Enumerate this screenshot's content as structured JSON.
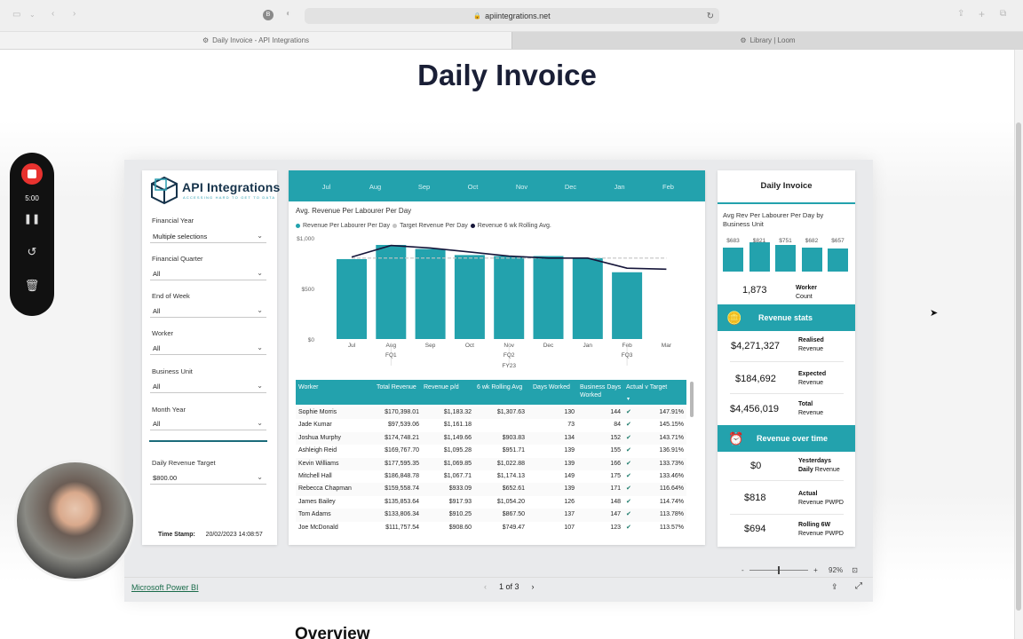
{
  "browser": {
    "url": "apiintegrations.net",
    "tabs": [
      {
        "label": "Daily Invoice - API Integrations"
      },
      {
        "label": "Library | Loom"
      }
    ]
  },
  "page": {
    "title": "Daily Invoice",
    "next_section": "Overview"
  },
  "filters": {
    "logo_name": "API Integrations",
    "logo_tagline": "ACCESSING HARD TO GET TO DATA",
    "fields": [
      {
        "label": "Financial Year",
        "value": "Multiple selections"
      },
      {
        "label": "Financial Quarter",
        "value": "All"
      },
      {
        "label": "End of Week",
        "value": "All"
      },
      {
        "label": "Worker",
        "value": "All"
      },
      {
        "label": "Business Unit",
        "value": "All"
      },
      {
        "label": "Month Year",
        "value": "All"
      },
      {
        "label": "Daily Revenue Target",
        "value": "$800.00"
      }
    ],
    "timestamp_label": "Time Stamp:",
    "timestamp_value": "20/02/2023 14:08:57"
  },
  "months": [
    "Jul",
    "Aug",
    "Sep",
    "Oct",
    "Nov",
    "Dec",
    "Jan",
    "Feb"
  ],
  "chart_data": {
    "type": "bar",
    "title": "Avg. Revenue Per Labourer Per Day",
    "categories": [
      "Jul",
      "Aug",
      "Sep",
      "Oct",
      "Nov",
      "Dec",
      "Jan",
      "Feb",
      "Mar"
    ],
    "quarter_labels": [
      "FQ1",
      "FQ2",
      "FQ3"
    ],
    "year_label": "FY23",
    "ytick_labels": [
      "$1,000",
      "$500",
      "$0"
    ],
    "ylim": [
      0,
      1000
    ],
    "series": [
      {
        "name": "Revenue Per Labourer Per Day",
        "type": "bar",
        "color": "#23a2ad",
        "values": [
          790,
          930,
          890,
          830,
          820,
          820,
          800,
          660,
          null
        ]
      },
      {
        "name": "Target Revenue Per Day",
        "type": "line",
        "color": "#c4c4c4",
        "values": [
          800,
          800,
          800,
          800,
          800,
          800,
          800,
          800,
          800
        ]
      },
      {
        "name": "Revenue 6 wk Rolling Avg.",
        "type": "line",
        "color": "#16163a",
        "values": [
          810,
          925,
          900,
          860,
          820,
          800,
          800,
          700,
          690
        ]
      }
    ]
  },
  "table": {
    "headers": [
      "Worker",
      "Total Revenue",
      "Revenue p/d",
      "6 wk Rolling Avg",
      "Days Worked",
      "Business Days Worked",
      "Actual v Target"
    ],
    "rows": [
      [
        "Sophie Morris",
        "$170,398.01",
        "$1,183.32",
        "$1,307.63",
        "130",
        "144",
        "147.91%"
      ],
      [
        "Jade Kumar",
        "$97,539.06",
        "$1,161.18",
        "",
        "73",
        "84",
        "145.15%"
      ],
      [
        "Joshua Murphy",
        "$174,748.21",
        "$1,149.66",
        "$903.83",
        "134",
        "152",
        "143.71%"
      ],
      [
        "Ashleigh Reid",
        "$169,767.70",
        "$1,095.28",
        "$951.71",
        "139",
        "155",
        "136.91%"
      ],
      [
        "Kevin Williams",
        "$177,595.35",
        "$1,069.85",
        "$1,022.88",
        "139",
        "166",
        "133.73%"
      ],
      [
        "Mitchell Hall",
        "$186,848.78",
        "$1,067.71",
        "$1,174.13",
        "149",
        "175",
        "133.46%"
      ],
      [
        "Rebecca Chapman",
        "$159,558.74",
        "$933.09",
        "$652.61",
        "139",
        "171",
        "116.64%"
      ],
      [
        "James Bailey",
        "$135,853.64",
        "$917.93",
        "$1,054.20",
        "126",
        "148",
        "114.74%"
      ],
      [
        "Tom Adams",
        "$133,806.34",
        "$910.25",
        "$867.50",
        "137",
        "147",
        "113.78%"
      ],
      [
        "Joe McDonald",
        "$111,757.54",
        "$908.60",
        "$749.47",
        "107",
        "123",
        "113.57%"
      ]
    ]
  },
  "summary": {
    "title": "Daily Invoice",
    "bu_title": "Avg Rev Per Labourer Per Day by Business Unit",
    "bu_values": [
      {
        "label": "$683",
        "value": 683
      },
      {
        "label": "$821",
        "value": 821
      },
      {
        "label": "$751",
        "value": 751
      },
      {
        "label": "$682",
        "value": 682
      },
      {
        "label": "$657",
        "value": 657
      }
    ],
    "worker_count": "1,873",
    "worker_label_1": "Worker",
    "worker_label_2": "Count",
    "revenue_stats_title": "Revenue stats",
    "stats": [
      {
        "value": "$4,271,327",
        "l1": "Realised",
        "l2": "Revenue"
      },
      {
        "value": "$184,692",
        "l1": "Expected",
        "l2": "Revenue"
      },
      {
        "value": "$4,456,019",
        "l1": "Total",
        "l2": "Revenue"
      }
    ],
    "revenue_over_time_title": "Revenue over time",
    "over_time": [
      {
        "value": "$0",
        "l1": "Yesterdays",
        "l1b": "Daily",
        "l2": "Revenue"
      },
      {
        "value": "$818",
        "l1": "Actual",
        "l2": "Revenue PWPD"
      },
      {
        "value": "$694",
        "l1": "Rolling 6W",
        "l2": "Revenue PWPD"
      }
    ]
  },
  "footer": {
    "link": "Microsoft Power BI",
    "page": "1 of 3",
    "zoom": "92%"
  },
  "loom": {
    "time": "5:00"
  },
  "colors": {
    "teal": "#23a2ad",
    "dark": "#16163a",
    "target": "#c4c4c4",
    "record": "#e8322f"
  }
}
